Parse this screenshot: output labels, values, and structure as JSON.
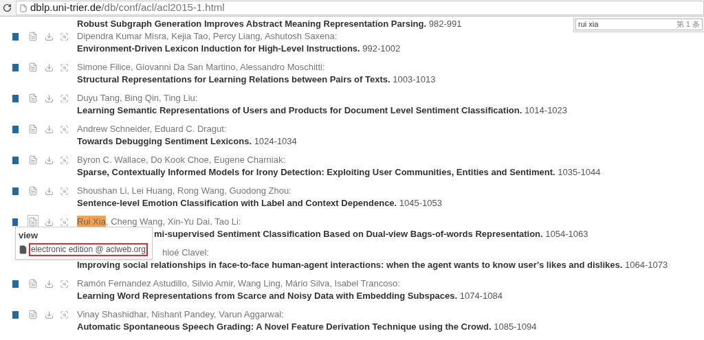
{
  "address_bar": {
    "domain": "dblp.uni-trier.de",
    "path": "/db/conf/acl/acl2015-1.html"
  },
  "find_bar": {
    "value": "rui xia",
    "count": "第 1 条"
  },
  "entries": [
    {
      "kind": "cut",
      "title": "Robust Subgraph Generation Improves Abstract Meaning Representation Parsing.",
      "pages": "982-991"
    },
    {
      "kind": "entry",
      "authors": [
        {
          "text": "Dipendra Kumar Misra, Kejia Tao, Percy Liang, Ashutosh Saxena:",
          "highlighted": false
        }
      ],
      "title": "Environment-Driven Lexicon Induction for High-Level Instructions.",
      "pages": "992-1002"
    },
    {
      "kind": "entry",
      "authors": [
        {
          "text": "Simone Filice, Giovanni Da San Martino, Alessandro Moschitti:",
          "highlighted": false
        }
      ],
      "title": "Structural Representations for Learning Relations between Pairs of Texts.",
      "pages": "1003-1013"
    },
    {
      "kind": "entry",
      "authors": [
        {
          "text": "Duyu Tang, Bing Qin, Ting Liu:",
          "highlighted": false
        }
      ],
      "title": "Learning Semantic Representations of Users and Products for Document Level Sentiment Classification.",
      "pages": "1014-1023"
    },
    {
      "kind": "entry",
      "authors": [
        {
          "text": "Andrew Schneider, Eduard C. Dragut:",
          "highlighted": false
        }
      ],
      "title": "Towards Debugging Sentiment Lexicons.",
      "pages": "1024-1034"
    },
    {
      "kind": "entry",
      "authors": [
        {
          "text": "Byron C. Wallace, Do Kook Choe, Eugene Charniak:",
          "highlighted": false
        }
      ],
      "title": "Sparse, Contextually Informed Models for Irony Detection: Exploiting User Communities, Entities and Sentiment.",
      "pages": "1035-1044"
    },
    {
      "kind": "entry",
      "authors": [
        {
          "text": "Shoushan Li, Lei Huang, Rong Wang, Guodong Zhou:",
          "highlighted": false
        }
      ],
      "title": "Sentence-level Emotion Classification with Label and Context Dependence.",
      "pages": "1045-1053"
    },
    {
      "kind": "hovered",
      "authors": [
        {
          "text": "Rui Xia",
          "highlighted": true
        },
        {
          "text": ", Cheng Wang, Xin-Yu Dai, Tao Li:",
          "highlighted": false
        }
      ],
      "title": "mi-supervised Sentiment Classification Based on Dual-view Bags-of-words Representation.",
      "pages": "1054-1063",
      "popup": {
        "heading": "view",
        "link": "electronic edition @ aclweb.org"
      }
    },
    {
      "kind": "covered",
      "authors": [
        {
          "text": "hloé Clavel:",
          "highlighted": false
        }
      ],
      "title": "Improving social relationships in face-to-face human-agent interactions: when the agent wants to know user's likes and dislikes.",
      "pages": "1064-1073"
    },
    {
      "kind": "entry",
      "authors": [
        {
          "text": "Ramón Fernandez Astudillo, Silvio Amir, Wang Ling, Mário Silva, Isabel Trancoso:",
          "highlighted": false
        }
      ],
      "title": "Learning Word Representations from Scarce and Noisy Data with Embedding Subspaces.",
      "pages": "1074-1084"
    },
    {
      "kind": "entry",
      "authors": [
        {
          "text": "Vinay Shashidhar, Nishant Pandey, Varun Aggarwal:",
          "highlighted": false
        }
      ],
      "title": "Automatic Spontaneous Speech Grading: A Novel Feature Derivation Technique using the Crowd.",
      "pages": "1085-1094"
    }
  ]
}
